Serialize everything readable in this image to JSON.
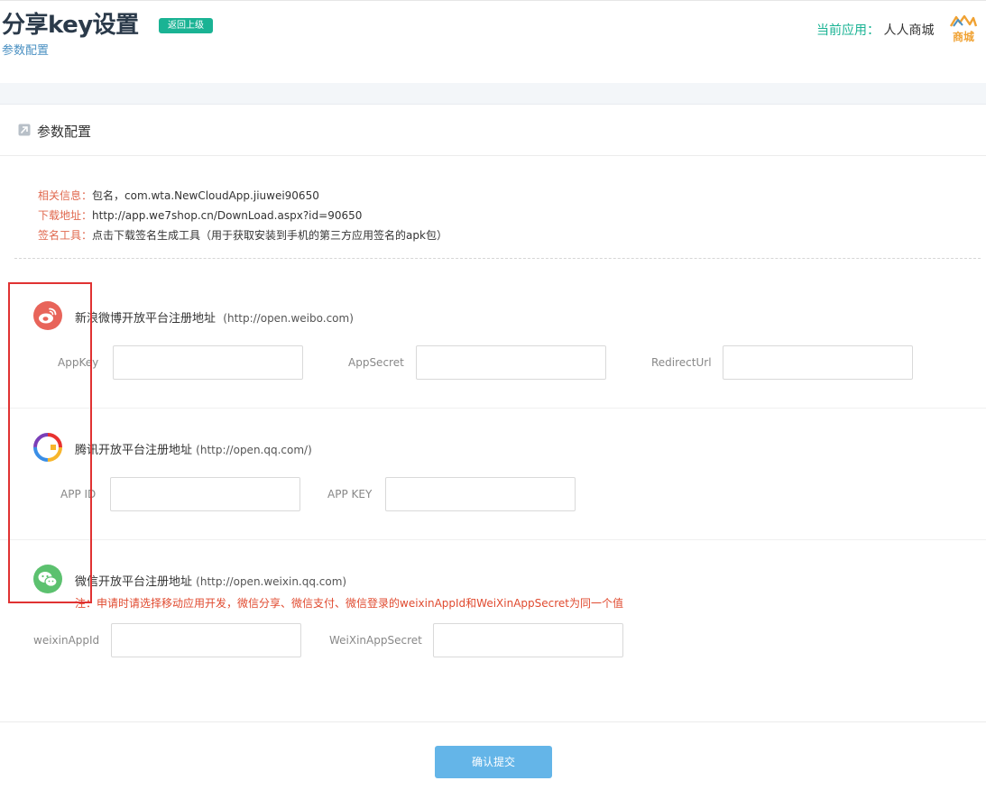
{
  "header": {
    "title": "分享key设置",
    "back_label": "返回上级",
    "breadcrumb": "参数配置",
    "current_app_label": "当前应用：",
    "current_app_value": "人人商城",
    "logo_text": "商城"
  },
  "panel": {
    "title": "参数配置",
    "info": [
      {
        "key": "相关信息：",
        "value": "包名，com.wta.NewCloudApp.jiuwei90650"
      },
      {
        "key": "下载地址：",
        "value": "http://app.we7shop.cn/DownLoad.aspx?id=90650"
      },
      {
        "key": "签名工具：",
        "value": "点击下载签名生成工具（用于获取安装到手机的第三方应用签名的apk包）"
      }
    ]
  },
  "weibo": {
    "title": "新浪微博开放平台注册地址",
    "url": "(http://open.weibo.com)",
    "fields": [
      {
        "label": "AppKey",
        "value": ""
      },
      {
        "label": "AppSecret",
        "value": ""
      },
      {
        "label": "RedirectUrl",
        "value": ""
      }
    ]
  },
  "tencent": {
    "title": "腾讯开放平台注册地址",
    "url": "(http://open.qq.com/)",
    "fields": [
      {
        "label": "APP ID",
        "value": ""
      },
      {
        "label": "APP KEY",
        "value": ""
      }
    ]
  },
  "wechat": {
    "title": "微信开放平台注册地址",
    "url": "(http://open.weixin.qq.com)",
    "note": "注：申请时请选择移动应用开发，微信分享、微信支付、微信登录的weixinAppId和WeiXinAppSecret为同一个值",
    "fields": [
      {
        "label": "weixinAppId",
        "value": ""
      },
      {
        "label": "WeiXinAppSecret",
        "value": ""
      }
    ]
  },
  "submit_label": "确认提交",
  "colors": {
    "accent_green": "#1ab394",
    "link_blue": "#4a90c2",
    "info_key_red": "#e0684e",
    "note_red": "#e04a2f",
    "submit_blue": "#64b5e8",
    "weibo_red": "#e8645a",
    "wechat_green": "#5cc16f"
  }
}
